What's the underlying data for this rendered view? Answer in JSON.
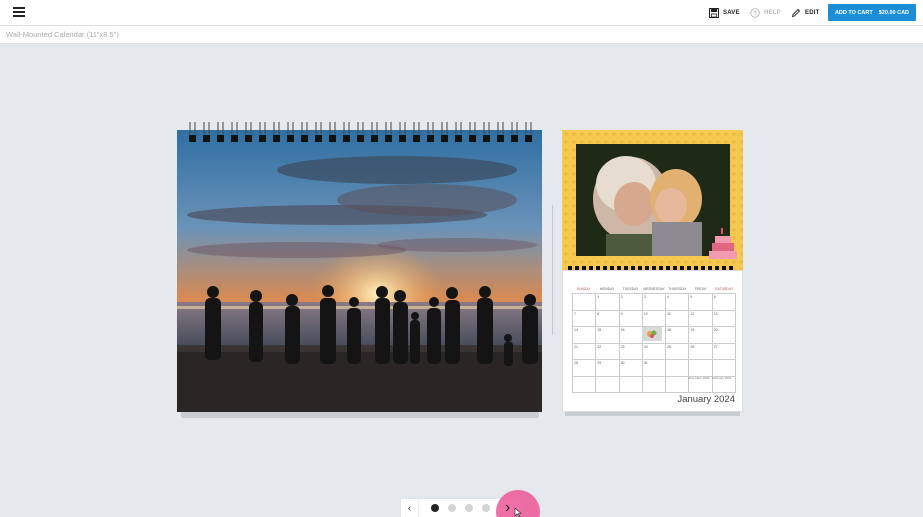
{
  "toolbar": {
    "menu_icon": "hamburger-menu-icon",
    "save_label": "SAVE",
    "help_label": "HELP",
    "edit_label": "EDIT",
    "cart_label": "ADD TO CART",
    "cart_price": "$20.00 CAD"
  },
  "product": {
    "title": "Wall-Mounted Calendar (11\"x8.5\")"
  },
  "calendar": {
    "month_label": "January 2024",
    "weekdays": [
      "SUNDAY",
      "MONDAY",
      "TUESDAY",
      "WEDNESDAY",
      "THURSDAY",
      "FRIDAY",
      "SATURDAY"
    ],
    "days": [
      "",
      "1",
      "2",
      "3",
      "4",
      "5",
      "6",
      "7",
      "8",
      "9",
      "10",
      "11",
      "12",
      "13",
      "14",
      "15",
      "16",
      "17",
      "18",
      "19",
      "20",
      "21",
      "22",
      "23",
      "24",
      "25",
      "26",
      "27",
      "28",
      "29",
      "30",
      "31",
      "",
      "",
      "",
      "",
      "",
      "",
      "",
      "",
      "",
      ""
    ],
    "mini_prev": "December 2023",
    "mini_next": "February 2024"
  },
  "pager": {
    "prev_label": "‹",
    "next_label": "›",
    "page_count": 4,
    "active_page": 1
  },
  "colors": {
    "accent": "#1a8fd8",
    "click_highlight": "#ec5796",
    "cover_border": "#f5c84f"
  }
}
